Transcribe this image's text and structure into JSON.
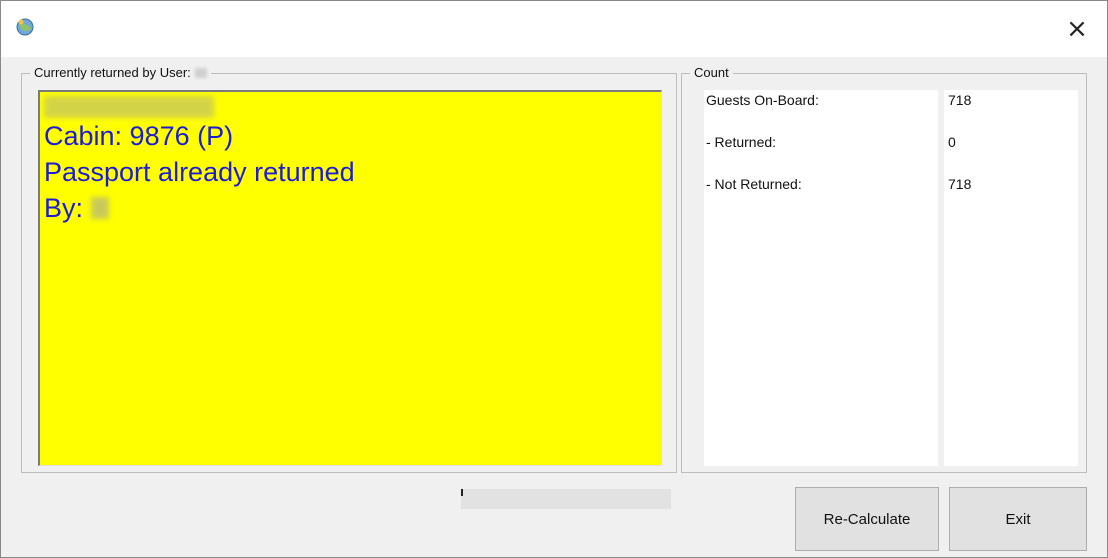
{
  "window": {
    "close_glyph": "×",
    "app_icon": "app-globe-icon"
  },
  "left_group": {
    "legend": "Currently returned by User:",
    "panel_bg": "#ffff00",
    "panel_fg": "#1c1cd6",
    "lines": {
      "cabin": "Cabin: 9876 (P)",
      "status": "Passport already returned",
      "by": "By:"
    }
  },
  "right_group": {
    "legend": "Count",
    "rows": [
      {
        "label": "Guests On-Board:",
        "value": "718"
      },
      {
        "label": "- Returned:",
        "value": "0"
      },
      {
        "label": "- Not Returned:",
        "value": "718"
      }
    ]
  },
  "buttons": {
    "recalculate": "Re-Calculate",
    "exit": "Exit"
  }
}
